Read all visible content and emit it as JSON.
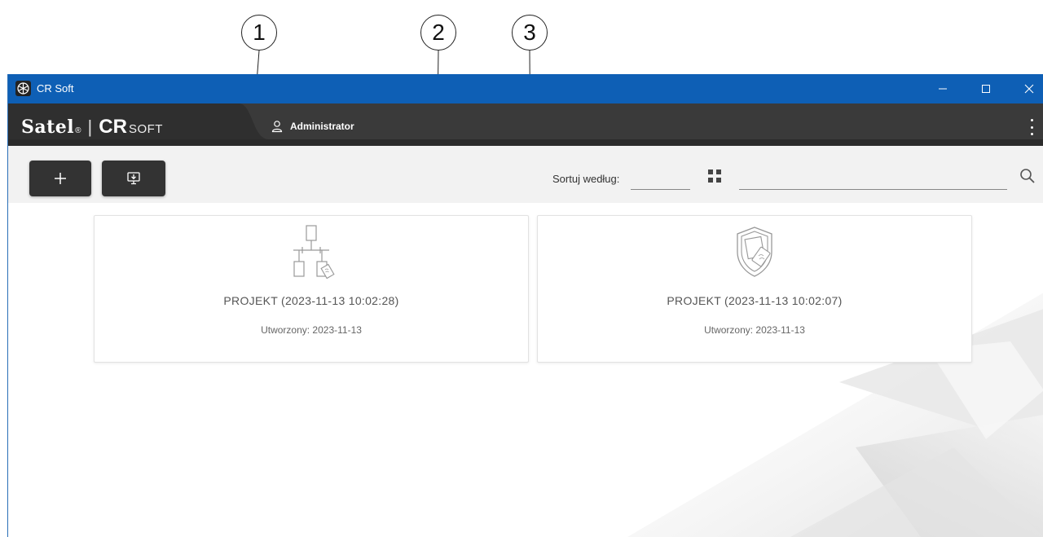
{
  "callouts": [
    "1",
    "2",
    "3"
  ],
  "window": {
    "title": "CR Soft",
    "controls": {
      "minimize": "—",
      "maximize": "☐",
      "close": "✕"
    }
  },
  "brand": {
    "name": "Satel",
    "reg": "®",
    "separator": "|",
    "product_main": "CR",
    "product_sub": "SOFT"
  },
  "user": {
    "name": "Administrator",
    "icon": "user-icon"
  },
  "toolbar": {
    "add_icon": "plus-icon",
    "import_icon": "monitor-download-icon",
    "sort_label": "Sortuj według:",
    "sort_value": "",
    "view_icon": "grid-view-icon",
    "search_value": "",
    "search_icon": "search-icon"
  },
  "projects": [
    {
      "name": "PROJEKT (2023-11-13 10:02:28)",
      "created": "Utworzony: 2023-11-13",
      "icon": "network-topology-icon"
    },
    {
      "name": "PROJEKT (2023-11-13 10:02:07)",
      "created": "Utworzony: 2023-11-13",
      "icon": "shield-card-icon"
    }
  ],
  "colors": {
    "titlebar": "#0e5fb5",
    "appbar": "#3a3a3a",
    "toolbar": "#f2f2f2",
    "button": "#333333"
  }
}
